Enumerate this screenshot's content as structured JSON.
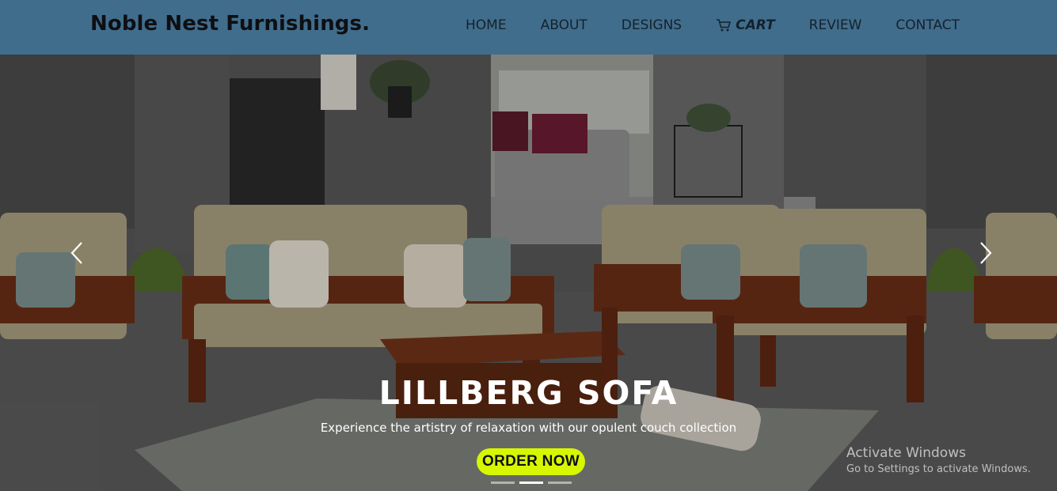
{
  "brand": {
    "name": "Noble Nest Furnishings."
  },
  "nav": {
    "items": [
      {
        "label": "HOME"
      },
      {
        "label": "ABOUT"
      },
      {
        "label": "DESIGNS"
      },
      {
        "label": "CART",
        "icon": "cart-icon"
      },
      {
        "label": "REVIEW"
      },
      {
        "label": "CONTACT"
      }
    ]
  },
  "hero": {
    "title": "LILLBERG SOFA",
    "subtitle": "Experience the artistry of relaxation with our opulent couch collection",
    "cta_label": "ORDER NOW",
    "prev_icon": "chevron-left-icon",
    "next_icon": "chevron-right-icon",
    "slides_total": 3,
    "active_slide": 2
  },
  "watermark": {
    "title": "Activate Windows",
    "subtitle": "Go to Settings to activate Windows."
  },
  "colors": {
    "navbar": "#416d8c",
    "cta": "#d6f700",
    "brand_text": "#0e0f12"
  }
}
